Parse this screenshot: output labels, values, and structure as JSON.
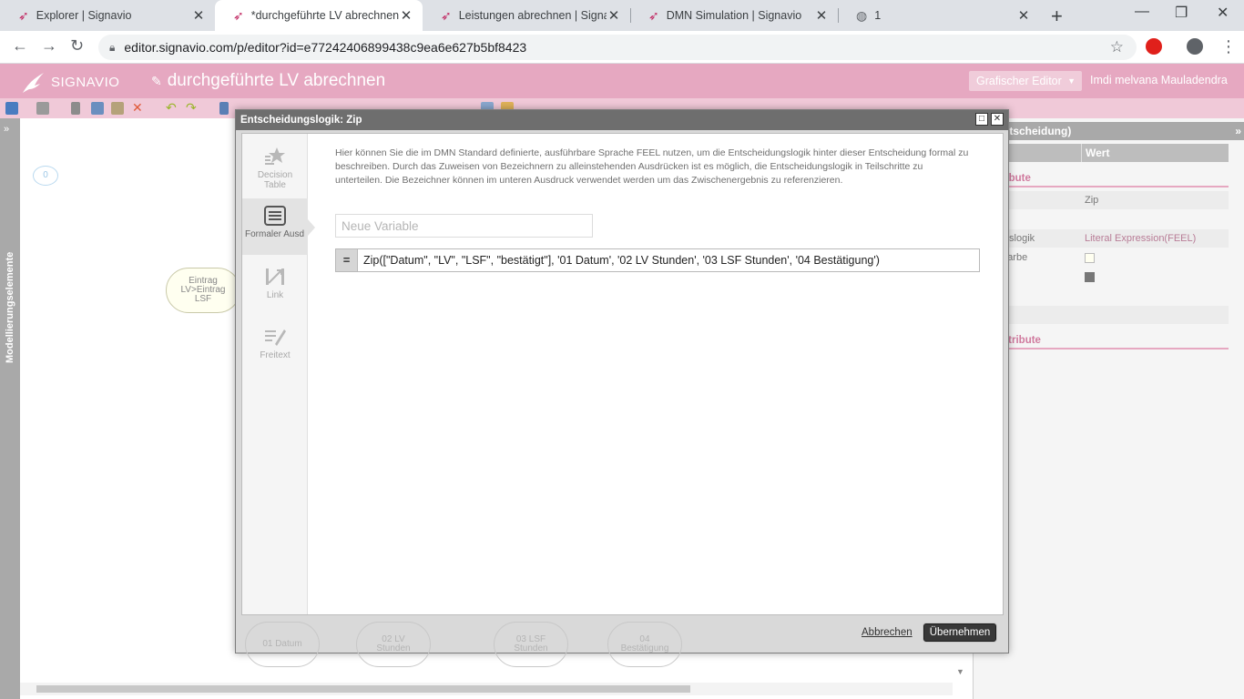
{
  "browser": {
    "tabs": [
      {
        "title": "Explorer | Signavio",
        "active": false
      },
      {
        "title": "*durchgeführte LV abrechnen | Signavio",
        "active": true
      },
      {
        "title": "Leistungen abrechnen | Signavio",
        "active": false
      },
      {
        "title": "DMN Simulation | Signavio",
        "active": false
      },
      {
        "title": "1",
        "active": false
      }
    ],
    "url": "editor.signavio.com/p/editor?id=e77242406899438c9ea6e627b5bf8423"
  },
  "app": {
    "logo_text": "SIGNAVIO",
    "document_title": "durchgeführte LV abrechnen",
    "editor_mode": "Grafischer Editor",
    "user_name": "Imdi melvana Mauladendra",
    "brand_color": "#e6a8c1"
  },
  "left_panel": {
    "label": "Modellierungselemente"
  },
  "canvas": {
    "comment_count": "0",
    "node_label_line1": "Eintrag",
    "node_label_line2": "LV>Eintrag",
    "node_label_line3": "LSF"
  },
  "properties": {
    "title": "te (Entscheidung)",
    "col_attribute": "t",
    "col_value": "Wert",
    "groups": {
      "main": "ptattribute",
      "more": "ere Attribute"
    },
    "rows": [
      {
        "key": "",
        "value": "Zip"
      },
      {
        "key": "eibung",
        "value": ""
      },
      {
        "key": "eidungslogik",
        "value": "Literal Expression(FEEL)"
      },
      {
        "key": "grundfarbe",
        "value": ""
      },
      {
        "key": "nfarbe",
        "value": ""
      },
      {
        "key": "rten",
        "value": ""
      }
    ],
    "bg_color_value": "#fffff0",
    "line_color_value": "#777777"
  },
  "dialog": {
    "title": "Entscheidungslogik: Zip",
    "modes": [
      {
        "label_line1": "Decision",
        "label_line2": "Table",
        "icon": "decision-table-icon"
      },
      {
        "label_line1": "Formaler Ausd",
        "label_line2": "",
        "icon": "formal-expression-icon"
      },
      {
        "label_line1": "Link",
        "label_line2": "",
        "icon": "link-icon"
      },
      {
        "label_line1": "Freitext",
        "label_line2": "",
        "icon": "free-text-icon"
      }
    ],
    "help_text": "Hier können Sie die im DMN Standard definierte, ausführbare Sprache FEEL nutzen, um die Entscheidungslogik hinter dieser Entscheidung formal zu beschreiben. Durch das Zuweisen von Bezeichnern zu alleinstehenden Ausdrücken ist es möglich, die Entscheidungslogik in Teilschritte zu unterteilen. Die Bezeichner können im unteren Ausdruck verwendet werden um das Zwischenergebnis zu referenzieren.",
    "variable_placeholder": "Neue Variable",
    "expression_prefix": "=",
    "expression": "Zip([\"Datum\", \"LV\", \"LSF\", \"bestätigt\"], '01 Datum', '02 LV Stunden', '03 LSF Stunden', '04 Bestätigung')",
    "cancel_label": "Abbrechen",
    "apply_label": "Übernehmen",
    "bg_nodes": [
      {
        "line1": "01 Datum",
        "line2": ""
      },
      {
        "line1": "02 LV",
        "line2": "Stunden"
      },
      {
        "line1": "03 LSF",
        "line2": "Stunden"
      },
      {
        "line1": "04",
        "line2": "Bestätigung"
      }
    ]
  }
}
